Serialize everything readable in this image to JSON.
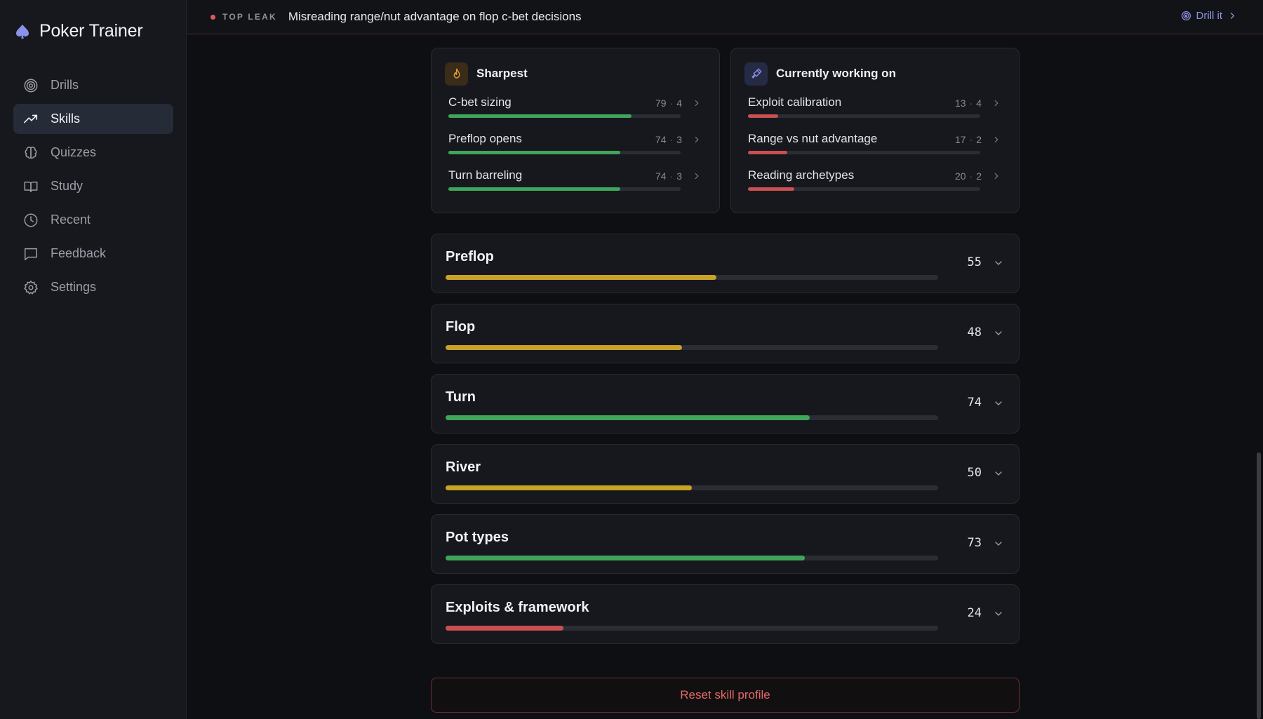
{
  "app": {
    "title": "Poker Trainer"
  },
  "nav": {
    "items": [
      {
        "label": "Drills",
        "icon": "target-icon",
        "active": false
      },
      {
        "label": "Skills",
        "icon": "trending-up-icon",
        "active": true
      },
      {
        "label": "Quizzes",
        "icon": "brain-icon",
        "active": false
      },
      {
        "label": "Study",
        "icon": "book-icon",
        "active": false
      },
      {
        "label": "Recent",
        "icon": "clock-icon",
        "active": false
      },
      {
        "label": "Feedback",
        "icon": "message-icon",
        "active": false
      },
      {
        "label": "Settings",
        "icon": "gear-icon",
        "active": false
      }
    ]
  },
  "banner": {
    "tag": "TOP LEAK",
    "text": "Misreading range/nut advantage on flop c-bet decisions",
    "action": "Drill it"
  },
  "sharpest": {
    "title": "Sharpest",
    "items": [
      {
        "name": "C-bet sizing",
        "score": "79",
        "count": "4",
        "level": 79
      },
      {
        "name": "Preflop opens",
        "score": "74",
        "count": "3",
        "level": 74
      },
      {
        "name": "Turn barreling",
        "score": "74",
        "count": "3",
        "level": 74
      }
    ]
  },
  "working": {
    "title": "Currently working on",
    "items": [
      {
        "name": "Exploit calibration",
        "score": "13",
        "count": "4",
        "level": 13
      },
      {
        "name": "Range vs nut advantage",
        "score": "17",
        "count": "2",
        "level": 17
      },
      {
        "name": "Reading archetypes",
        "score": "20",
        "count": "2",
        "level": 20
      }
    ]
  },
  "sections": [
    {
      "title": "Preflop",
      "score": "55",
      "level": 55
    },
    {
      "title": "Flop",
      "score": "48",
      "level": 48
    },
    {
      "title": "Turn",
      "score": "74",
      "level": 74
    },
    {
      "title": "River",
      "score": "50",
      "level": 50
    },
    {
      "title": "Pot types",
      "score": "73",
      "level": 73
    },
    {
      "title": "Exploits & framework",
      "score": "24",
      "level": 24
    }
  ],
  "reset": {
    "label": "Reset skill profile"
  },
  "colors": {
    "good": "#3fa55a",
    "mid": "#c9a227",
    "bad": "#c85050",
    "accent": "#8b93e8"
  }
}
